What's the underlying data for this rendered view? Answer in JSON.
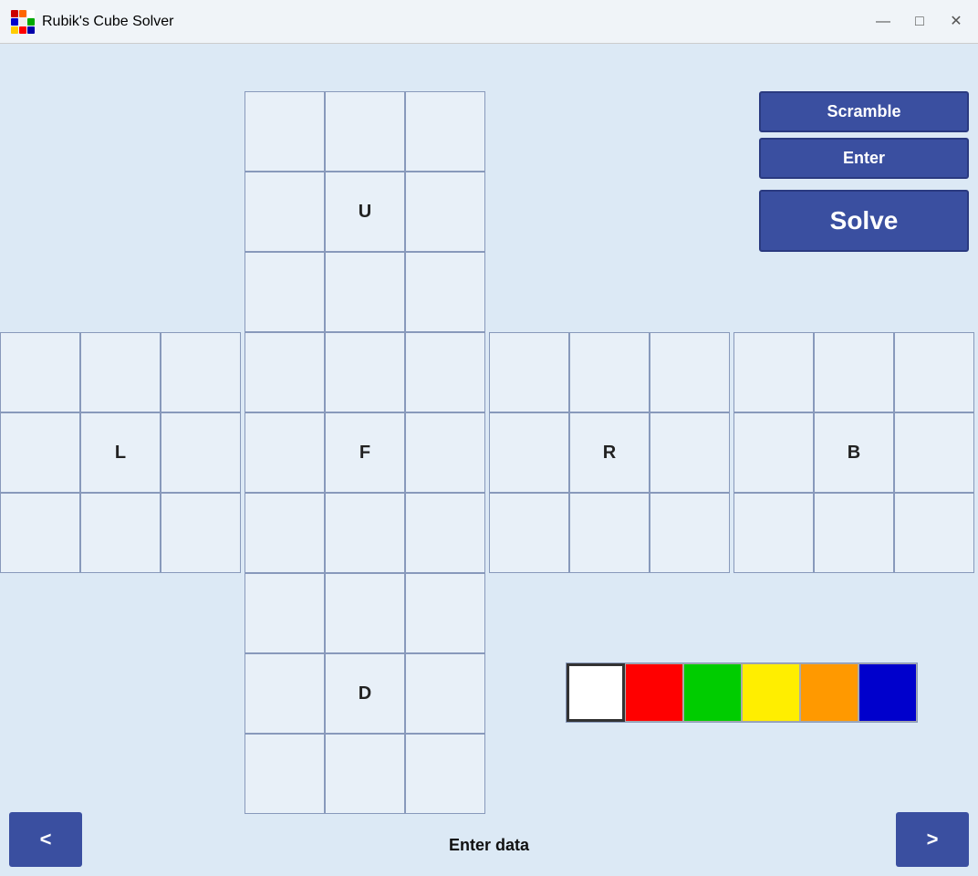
{
  "titlebar": {
    "app_title": "Rubik's Cube Solver",
    "minimize_label": "—",
    "maximize_label": "□",
    "close_label": "✕"
  },
  "buttons": {
    "scramble_label": "Scramble",
    "enter_label": "Enter",
    "solve_label": "Solve",
    "nav_left_label": "<",
    "nav_right_label": ">"
  },
  "faces": {
    "U_label": "U",
    "L_label": "L",
    "F_label": "F",
    "R_label": "R",
    "B_label": "B",
    "D_label": "D"
  },
  "bottom": {
    "enter_data_label": "Enter data"
  },
  "colors": [
    {
      "name": "white",
      "hex": "#ffffff"
    },
    {
      "name": "red",
      "hex": "#ff0000"
    },
    {
      "name": "green",
      "hex": "#00cc00"
    },
    {
      "name": "yellow",
      "hex": "#ffee00"
    },
    {
      "name": "orange",
      "hex": "#ff9900"
    },
    {
      "name": "blue",
      "hex": "#0000cc"
    }
  ],
  "cube_icon_colors": [
    "#cc0000",
    "#ff6600",
    "#ffffff",
    "#0000cc",
    "#f0f0f0",
    "#00aa00",
    "#ffcc00",
    "#ff0000",
    "#0000aa"
  ]
}
